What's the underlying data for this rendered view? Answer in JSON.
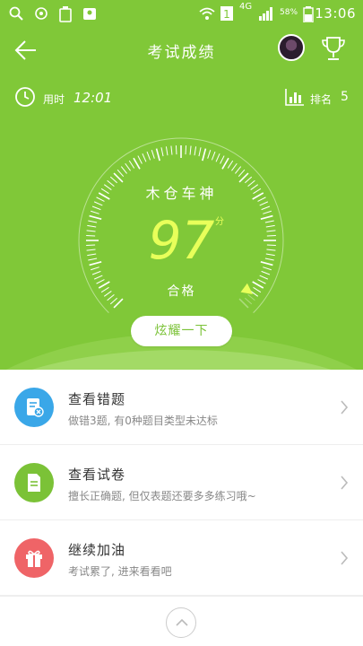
{
  "status_bar": {
    "time": "13:06",
    "network": "4G",
    "battery": "58%"
  },
  "header": {
    "title": "考试成绩"
  },
  "stats": {
    "duration_label": "用时",
    "duration_value": "12:01",
    "rank_label": "排名",
    "rank_value": "5"
  },
  "score_card": {
    "nickname": "木仓车神",
    "score": "97",
    "score_unit": "分",
    "result": "合格",
    "score_fraction": 0.97
  },
  "share_button": {
    "label": "炫耀一下"
  },
  "menu": [
    {
      "title": "查看错题",
      "subtitle": "做错3题, 有0种题目类型未达标",
      "icon": "wrong-questions-icon",
      "color": "#3aa7e8"
    },
    {
      "title": "查看试卷",
      "subtitle": "擅长正确题, 但仅表题还要多多练习哦~",
      "icon": "exam-paper-icon",
      "color": "#7bc237"
    },
    {
      "title": "继续加油",
      "subtitle": "考试累了, 进来看看吧",
      "icon": "gift-icon",
      "color": "#ef6467"
    }
  ],
  "colors": {
    "theme_green": "#80c838",
    "score_yellow": "#e8ff5a"
  }
}
